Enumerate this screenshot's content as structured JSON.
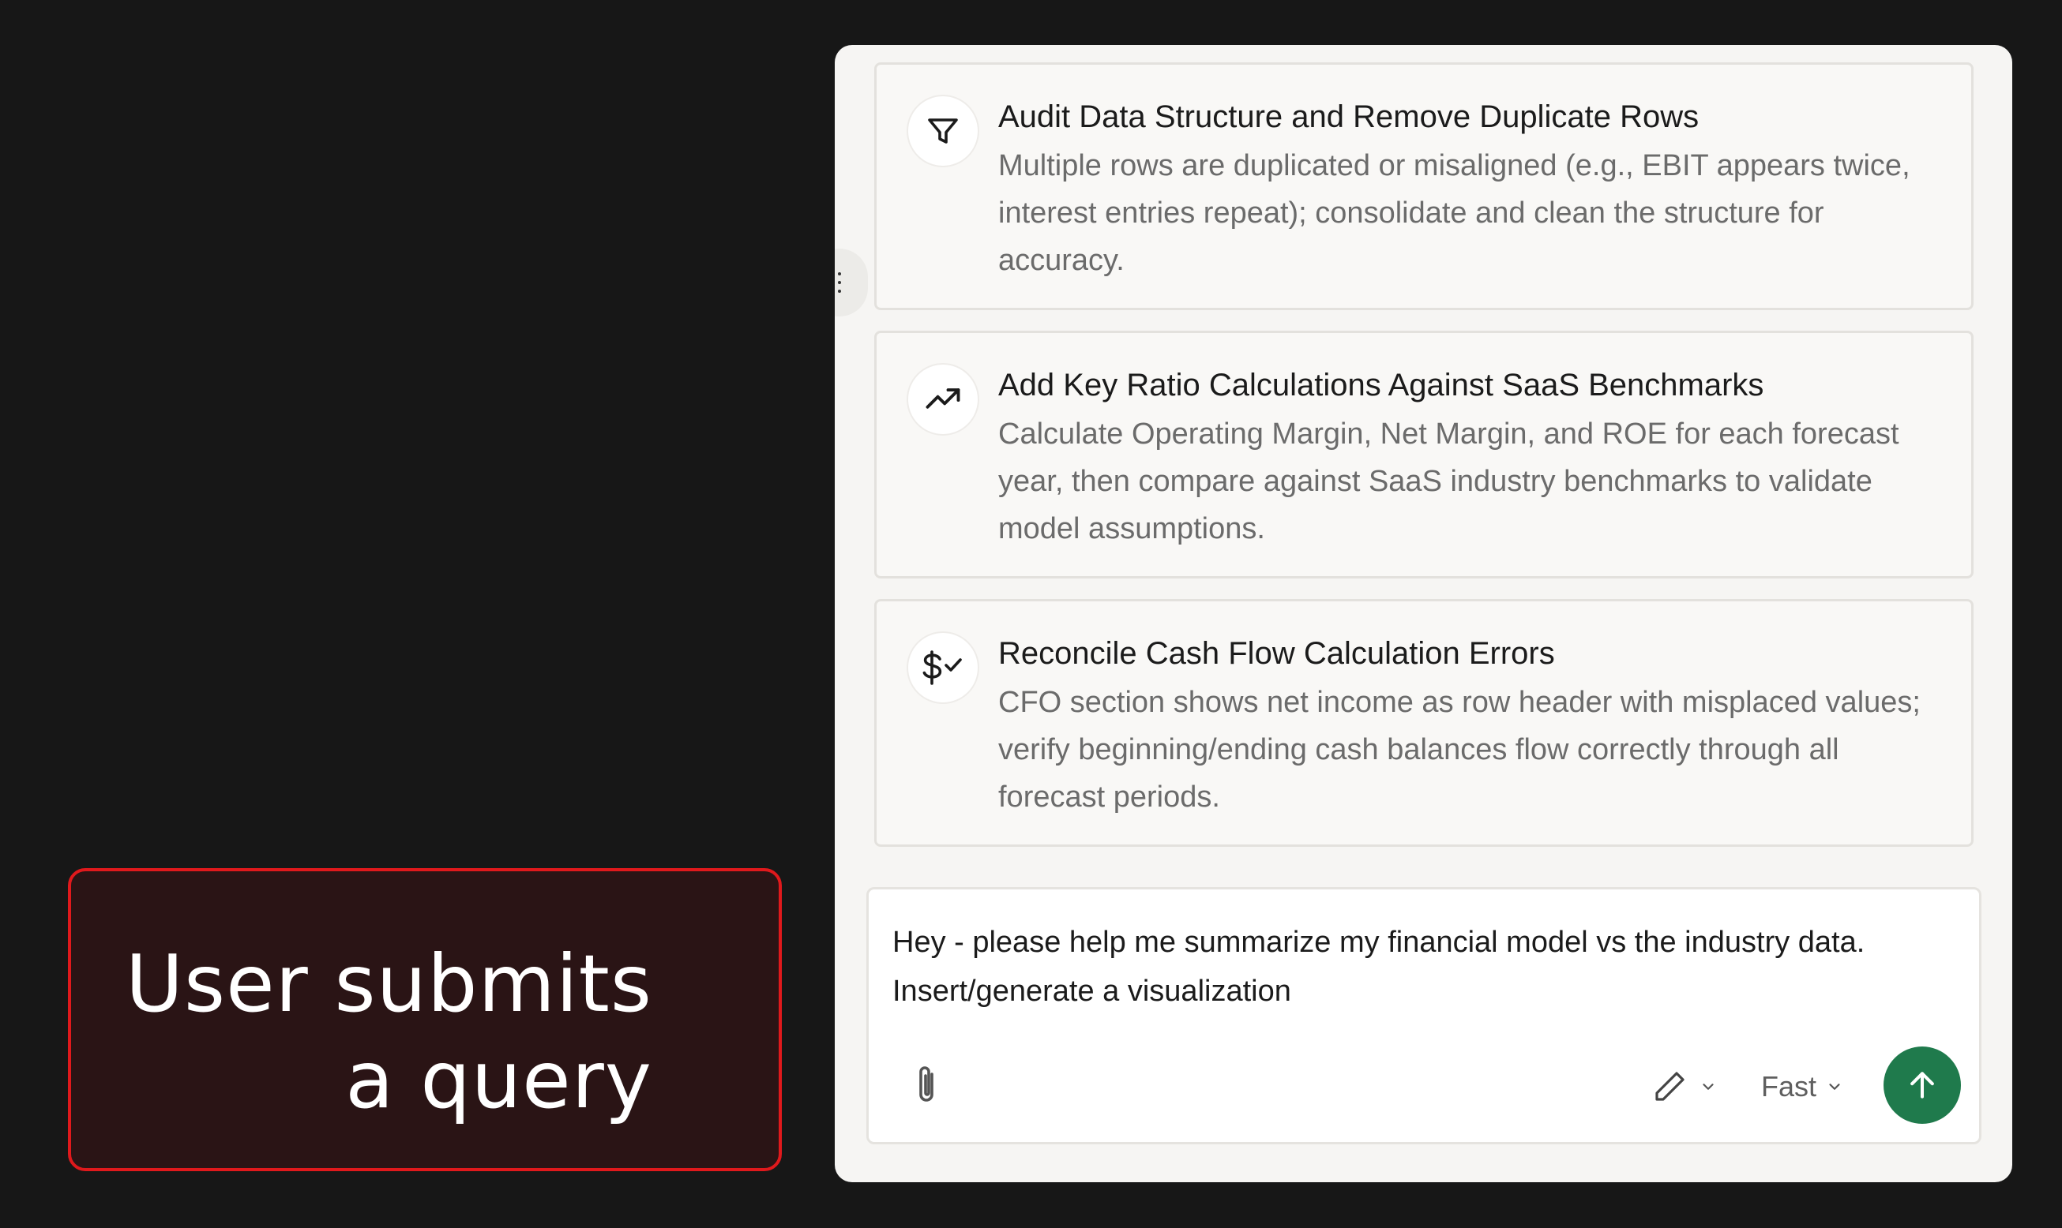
{
  "callout": {
    "line1": "User submits",
    "line2": "a query"
  },
  "cards": [
    {
      "icon": "filter-icon",
      "title": "Audit Data Structure and Remove Duplicate Rows",
      "description": "Multiple rows are duplicated or misaligned (e.g., EBIT appears twice, interest entries repeat); consolidate and clean the structure for accuracy."
    },
    {
      "icon": "trending-up-icon",
      "title": "Add Key Ratio Calculations Against SaaS Benchmarks",
      "description": "Calculate Operating Margin, Net Margin, and ROE for each forecast year, then compare against SaaS industry benchmarks to validate model assumptions."
    },
    {
      "icon": "dollar-check-icon",
      "title": "Reconcile Cash Flow Calculation Errors",
      "description": "CFO section shows net income as row header with misplaced values; verify beginning/ending cash balances flow correctly through all forecast periods."
    }
  ],
  "composer": {
    "text": "Hey - please help me summarize my financial model vs the industry data. Insert/generate a visualization",
    "mode_icon": "pencil-icon",
    "speed_label": "Fast",
    "send_icon": "arrow-up-icon",
    "attach_icon": "paperclip-icon"
  },
  "colors": {
    "background": "#171717",
    "callout_border": "#e0191c",
    "callout_fill": "#2a1415",
    "send_button": "#1f7a4c"
  }
}
